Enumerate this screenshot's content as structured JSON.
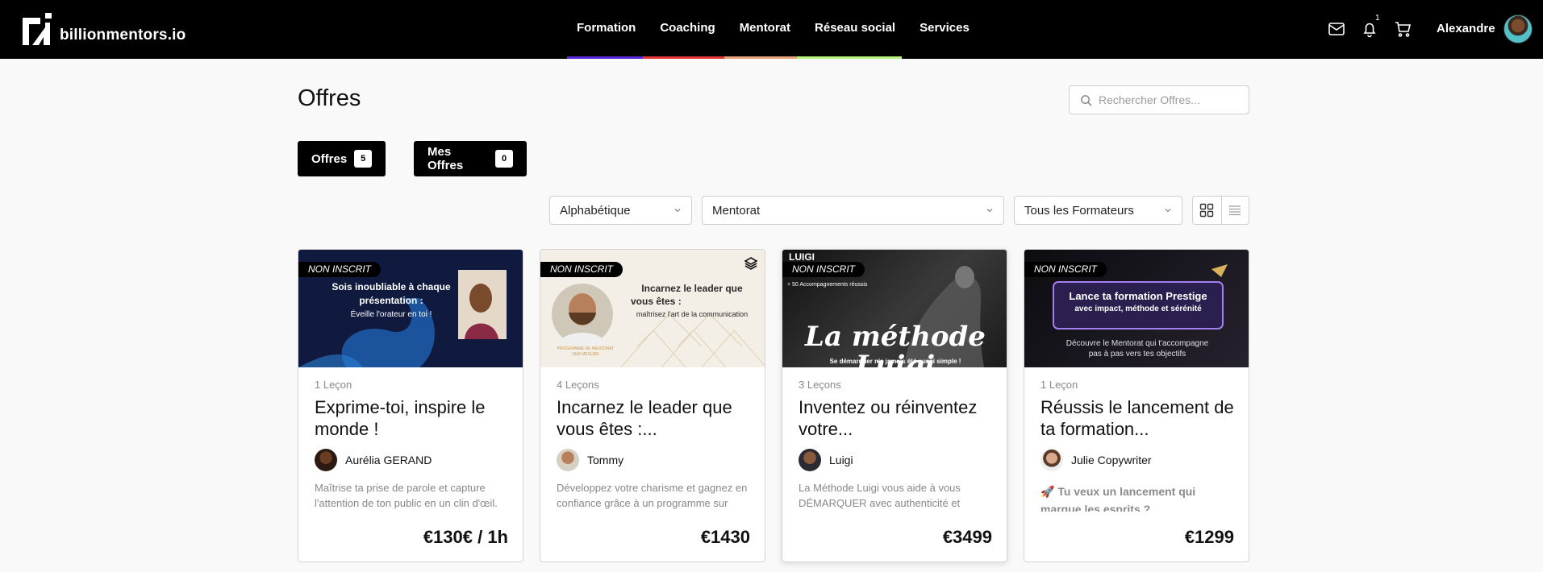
{
  "nav": {
    "brand": "billionmentors.io",
    "links": [
      {
        "label": "Formation",
        "color": "#5b2bd9"
      },
      {
        "label": "Coaching",
        "color": "#e5383b"
      },
      {
        "label": "Mentorat",
        "color": "#e8a27c"
      },
      {
        "label": "Réseau social",
        "color": "#b6f57a"
      },
      {
        "label": "Services",
        "color": ""
      }
    ],
    "icons": [
      "mail-icon",
      "bell-icon",
      "cart-icon"
    ],
    "notification_count": "1",
    "user_name": "Alexandre"
  },
  "page": {
    "title": "Offres",
    "search_placeholder": "Rechercher Offres..."
  },
  "tabs": [
    {
      "label": "Offres",
      "count": "5"
    },
    {
      "label": "Mes Offres",
      "count": "0"
    }
  ],
  "filters": {
    "sort": "Alphabétique",
    "category": "Mentorat",
    "trainer": "Tous les Formateurs"
  },
  "cards": [
    {
      "badge": "NON INSCRIT",
      "thumb_line1": "Sois inoubliable à chaque",
      "thumb_line2": "présentation :",
      "thumb_line3": "Éveille l'orateur en toi !",
      "lessons": "1 Leçon",
      "title": "Exprime-toi, inspire le monde !",
      "author": "Aurélia GERAND",
      "description": "Maîtrise ta prise de parole et capture l'attention de ton public en un clin d'œil.",
      "price": "€130€ / 1h"
    },
    {
      "badge": "NON INSCRIT",
      "thumb_line1": "Incarnez le leader que",
      "thumb_line2": "vous êtes :",
      "thumb_line3": "maîtrisez l'art de la communication",
      "thumb_line4": "PROGRAMME DE MENTORAT",
      "thumb_line5": "SUR MESURE",
      "lessons": "4 Leçons",
      "title": "Incarnez le leader que vous êtes :...",
      "author": "Tommy",
      "description": "Développez votre charisme et gagnez en confiance grâce à un programme sur mesure.",
      "price": "€1430"
    },
    {
      "badge": "NON INSCRIT",
      "thumb_logo": "LUIGI",
      "thumb_line1": "+ 50 Accompagnements réussis",
      "thumb_line2": "La méthode Luigi",
      "thumb_line3": "Se démarquer n'a jamais été aussi simple !",
      "lessons": "3 Leçons",
      "title": "Inventez ou réinventez votre...",
      "author": "Luigi",
      "description": "La Méthode Luigi vous aide à vous DÉMARQUER avec authenticité et impact.",
      "price": "€3499"
    },
    {
      "badge": "NON INSCRIT",
      "thumb_line1": "Lance ta formation Prestige",
      "thumb_line2": "avec impact, méthode et sérénité",
      "thumb_line3": "Découvre le Mentorat qui t'accompagne",
      "thumb_line4": "pas à pas vers tes objectifs",
      "lessons": "1 Leçon",
      "title": "Réussis le lancement de ta formation...",
      "author": "Julie Copywriter",
      "description": "🚀 Tu veux un lancement qui marque les esprits ?",
      "price": "€1299"
    }
  ]
}
